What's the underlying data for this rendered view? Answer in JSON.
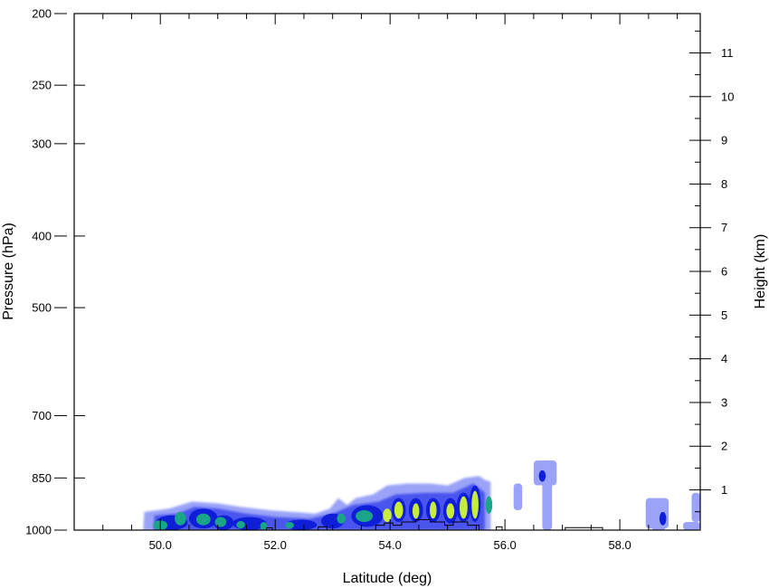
{
  "chart_data": {
    "type": "heatmap",
    "title": "",
    "xlabel": "Latitude (deg)",
    "ylabel": "Pressure (hPa)",
    "y2label": "Height (km)",
    "xlim": [
      48.5,
      59.4
    ],
    "ylim": [
      1000,
      200
    ],
    "y_scale": "log",
    "y2lim": [
      0.08,
      11.9
    ],
    "x_ticks": [
      {
        "value": 50.0,
        "label": "50.0"
      },
      {
        "value": 52.0,
        "label": "52.0"
      },
      {
        "value": 54.0,
        "label": "54.0"
      },
      {
        "value": 56.0,
        "label": "56.0"
      },
      {
        "value": 58.0,
        "label": "58.0"
      }
    ],
    "y_ticks": [
      {
        "value": 200,
        "label": "200"
      },
      {
        "value": 250,
        "label": "250"
      },
      {
        "value": 300,
        "label": "300"
      },
      {
        "value": 400,
        "label": "400"
      },
      {
        "value": 500,
        "label": "500"
      },
      {
        "value": 700,
        "label": "700"
      },
      {
        "value": 850,
        "label": "850"
      },
      {
        "value": 1000,
        "label": "1000"
      }
    ],
    "y2_ticks": [
      {
        "value": 1,
        "label": "1"
      },
      {
        "value": 2,
        "label": "2"
      },
      {
        "value": 3,
        "label": "3"
      },
      {
        "value": 4,
        "label": "4"
      },
      {
        "value": 5,
        "label": "5"
      },
      {
        "value": 6,
        "label": "6"
      },
      {
        "value": 7,
        "label": "7"
      },
      {
        "value": 8,
        "label": "8"
      },
      {
        "value": 9,
        "label": "9"
      },
      {
        "value": 10,
        "label": "10"
      },
      {
        "value": 11,
        "label": "11"
      }
    ],
    "grid": false,
    "legend": "none",
    "colors": {
      "level1": "#9aa3f7",
      "level2": "#4a55ee",
      "level3": "#0f1fd8",
      "level4": "#1aa58a",
      "level5": "#c8ec3c"
    },
    "cells": [
      {
        "lat": 50.2,
        "p_top": 955,
        "p_bot": 1000,
        "lat_w": 0.55,
        "level": 3
      },
      {
        "lat": 50.0,
        "p_top": 970,
        "p_bot": 1000,
        "lat_w": 0.25,
        "level": 4
      },
      {
        "lat": 50.35,
        "p_top": 945,
        "p_bot": 985,
        "lat_w": 0.2,
        "level": 4
      },
      {
        "lat": 50.75,
        "p_top": 935,
        "p_bot": 995,
        "lat_w": 0.5,
        "level": 3
      },
      {
        "lat": 50.75,
        "p_top": 950,
        "p_bot": 985,
        "lat_w": 0.25,
        "level": 4
      },
      {
        "lat": 51.1,
        "p_top": 955,
        "p_bot": 1000,
        "lat_w": 0.35,
        "level": 3
      },
      {
        "lat": 51.05,
        "p_top": 960,
        "p_bot": 990,
        "lat_w": 0.2,
        "level": 4
      },
      {
        "lat": 51.55,
        "p_top": 960,
        "p_bot": 1000,
        "lat_w": 0.6,
        "level": 3
      },
      {
        "lat": 51.4,
        "p_top": 972,
        "p_bot": 995,
        "lat_w": 0.15,
        "level": 4
      },
      {
        "lat": 51.8,
        "p_top": 975,
        "p_bot": 1000,
        "lat_w": 0.12,
        "level": 4
      },
      {
        "lat": 52.45,
        "p_top": 968,
        "p_bot": 1000,
        "lat_w": 0.55,
        "level": 3
      },
      {
        "lat": 52.25,
        "p_top": 975,
        "p_bot": 995,
        "lat_w": 0.15,
        "level": 4
      },
      {
        "lat": 53.0,
        "p_top": 950,
        "p_bot": 995,
        "lat_w": 0.4,
        "level": 3
      },
      {
        "lat": 53.15,
        "p_top": 950,
        "p_bot": 980,
        "lat_w": 0.15,
        "level": 4
      },
      {
        "lat": 53.6,
        "p_top": 925,
        "p_bot": 990,
        "lat_w": 0.55,
        "level": 3
      },
      {
        "lat": 53.55,
        "p_top": 940,
        "p_bot": 975,
        "lat_w": 0.3,
        "level": 4
      },
      {
        "lat": 53.95,
        "p_top": 935,
        "p_bot": 975,
        "lat_w": 0.15,
        "level": 5
      },
      {
        "lat": 54.15,
        "p_top": 905,
        "p_bot": 975,
        "lat_w": 0.25,
        "level": 3
      },
      {
        "lat": 54.15,
        "p_top": 915,
        "p_bot": 965,
        "lat_w": 0.15,
        "level": 5
      },
      {
        "lat": 54.45,
        "p_top": 905,
        "p_bot": 975,
        "lat_w": 0.25,
        "level": 3
      },
      {
        "lat": 54.45,
        "p_top": 920,
        "p_bot": 965,
        "lat_w": 0.12,
        "level": 5
      },
      {
        "lat": 54.75,
        "p_top": 905,
        "p_bot": 975,
        "lat_w": 0.25,
        "level": 3
      },
      {
        "lat": 54.75,
        "p_top": 915,
        "p_bot": 965,
        "lat_w": 0.12,
        "level": 5
      },
      {
        "lat": 55.05,
        "p_top": 905,
        "p_bot": 980,
        "lat_w": 0.25,
        "level": 3
      },
      {
        "lat": 55.05,
        "p_top": 920,
        "p_bot": 965,
        "lat_w": 0.14,
        "level": 5
      },
      {
        "lat": 55.28,
        "p_top": 890,
        "p_bot": 975,
        "lat_w": 0.25,
        "level": 3
      },
      {
        "lat": 55.28,
        "p_top": 900,
        "p_bot": 965,
        "lat_w": 0.14,
        "level": 5
      },
      {
        "lat": 55.48,
        "p_top": 870,
        "p_bot": 975,
        "lat_w": 0.2,
        "level": 3
      },
      {
        "lat": 55.48,
        "p_top": 885,
        "p_bot": 965,
        "lat_w": 0.12,
        "level": 5
      },
      {
        "lat": 55.72,
        "p_top": 900,
        "p_bot": 950,
        "lat_w": 0.12,
        "level": 4
      },
      {
        "lat": 56.65,
        "p_top": 830,
        "p_bot": 860,
        "lat_w": 0.12,
        "level": 3
      },
      {
        "lat": 58.75,
        "p_top": 945,
        "p_bot": 985,
        "lat_w": 0.12,
        "level": 3
      }
    ],
    "outer_envelope": [
      {
        "lat": 49.7,
        "p": 1000
      },
      {
        "lat": 49.72,
        "p": 945
      },
      {
        "lat": 50.15,
        "p": 935
      },
      {
        "lat": 50.55,
        "p": 915
      },
      {
        "lat": 51.0,
        "p": 920
      },
      {
        "lat": 51.4,
        "p": 930
      },
      {
        "lat": 51.9,
        "p": 940
      },
      {
        "lat": 52.3,
        "p": 945
      },
      {
        "lat": 52.7,
        "p": 950
      },
      {
        "lat": 52.95,
        "p": 935
      },
      {
        "lat": 53.1,
        "p": 905
      },
      {
        "lat": 53.25,
        "p": 925
      },
      {
        "lat": 53.4,
        "p": 905
      },
      {
        "lat": 53.7,
        "p": 895
      },
      {
        "lat": 53.95,
        "p": 870
      },
      {
        "lat": 54.3,
        "p": 865
      },
      {
        "lat": 54.7,
        "p": 865
      },
      {
        "lat": 55.0,
        "p": 870
      },
      {
        "lat": 55.3,
        "p": 850
      },
      {
        "lat": 55.55,
        "p": 845
      },
      {
        "lat": 55.65,
        "p": 855
      },
      {
        "lat": 55.75,
        "p": 860
      },
      {
        "lat": 55.75,
        "p": 1000
      }
    ],
    "level2_envelope": [
      {
        "lat": 49.88,
        "p": 1000
      },
      {
        "lat": 49.9,
        "p": 955
      },
      {
        "lat": 50.3,
        "p": 950
      },
      {
        "lat": 50.6,
        "p": 930
      },
      {
        "lat": 51.0,
        "p": 935
      },
      {
        "lat": 51.5,
        "p": 950
      },
      {
        "lat": 52.0,
        "p": 960
      },
      {
        "lat": 52.6,
        "p": 965
      },
      {
        "lat": 53.0,
        "p": 950
      },
      {
        "lat": 53.35,
        "p": 925
      },
      {
        "lat": 53.8,
        "p": 915
      },
      {
        "lat": 54.1,
        "p": 895
      },
      {
        "lat": 54.6,
        "p": 890
      },
      {
        "lat": 55.1,
        "p": 890
      },
      {
        "lat": 55.45,
        "p": 865
      },
      {
        "lat": 55.65,
        "p": 890
      },
      {
        "lat": 55.65,
        "p": 1000
      }
    ],
    "isolated_patches": [
      {
        "lat0": 56.15,
        "lat1": 56.3,
        "p_top": 865,
        "p_bot": 940
      },
      {
        "lat0": 56.5,
        "lat1": 56.9,
        "p_top": 805,
        "p_bot": 870
      },
      {
        "lat0": 56.65,
        "lat1": 56.82,
        "p_top": 860,
        "p_bot": 1000
      },
      {
        "lat0": 58.45,
        "lat1": 58.85,
        "p_top": 905,
        "p_bot": 995
      },
      {
        "lat0": 58.55,
        "lat1": 58.8,
        "p_top": 930,
        "p_bot": 1000
      },
      {
        "lat0": 59.1,
        "lat1": 59.4,
        "p_top": 975,
        "p_bot": 1000
      },
      {
        "lat0": 59.25,
        "lat1": 59.4,
        "p_top": 890,
        "p_bot": 975
      }
    ],
    "terrain": [
      {
        "lat": 51.85,
        "p": 1000
      },
      {
        "lat": 51.85,
        "p": 993
      },
      {
        "lat": 51.95,
        "p": 993
      },
      {
        "lat": 51.95,
        "p": 1000
      },
      {
        "lat": 52.75,
        "p": 1000
      },
      {
        "lat": 52.75,
        "p": 990
      },
      {
        "lat": 52.9,
        "p": 990
      },
      {
        "lat": 52.9,
        "p": 1000
      },
      {
        "lat": 53.75,
        "p": 1000
      },
      {
        "lat": 53.75,
        "p": 985
      },
      {
        "lat": 53.9,
        "p": 985
      },
      {
        "lat": 53.9,
        "p": 978
      },
      {
        "lat": 54.05,
        "p": 978
      },
      {
        "lat": 54.05,
        "p": 985
      },
      {
        "lat": 54.2,
        "p": 985
      },
      {
        "lat": 54.2,
        "p": 975
      },
      {
        "lat": 54.45,
        "p": 975
      },
      {
        "lat": 54.45,
        "p": 968
      },
      {
        "lat": 54.7,
        "p": 968
      },
      {
        "lat": 54.7,
        "p": 975
      },
      {
        "lat": 54.95,
        "p": 975
      },
      {
        "lat": 54.95,
        "p": 985
      },
      {
        "lat": 55.1,
        "p": 985
      },
      {
        "lat": 55.1,
        "p": 975
      },
      {
        "lat": 55.35,
        "p": 975
      },
      {
        "lat": 55.35,
        "p": 985
      },
      {
        "lat": 55.55,
        "p": 985
      },
      {
        "lat": 55.55,
        "p": 1000
      },
      {
        "lat": 55.85,
        "p": 1000
      },
      {
        "lat": 55.85,
        "p": 990
      },
      {
        "lat": 55.95,
        "p": 990
      },
      {
        "lat": 55.95,
        "p": 1000
      },
      {
        "lat": 57.05,
        "p": 1000
      },
      {
        "lat": 57.05,
        "p": 992
      },
      {
        "lat": 57.7,
        "p": 992
      },
      {
        "lat": 57.7,
        "p": 1000
      }
    ]
  }
}
